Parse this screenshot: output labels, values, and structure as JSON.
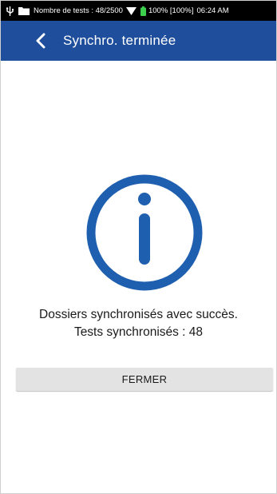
{
  "status_bar": {
    "tests_count": "Nombre de tests : 48/2500",
    "battery": "100% [100%]",
    "time": "06:24 AM",
    "icons": [
      "usb-icon",
      "folder-icon",
      "wifi-icon",
      "battery-icon"
    ]
  },
  "app_bar": {
    "title": "Synchro. terminée",
    "back_icon": "chevron-left-icon",
    "color": "#1f4e9c"
  },
  "content": {
    "icon": "info-icon",
    "icon_color": "#1f5fb0",
    "message_line_1": "Dossiers synchronisés avec succès.",
    "message_line_2": "Tests synchronisés : 48"
  },
  "actions": {
    "close_label": "FERMER"
  }
}
